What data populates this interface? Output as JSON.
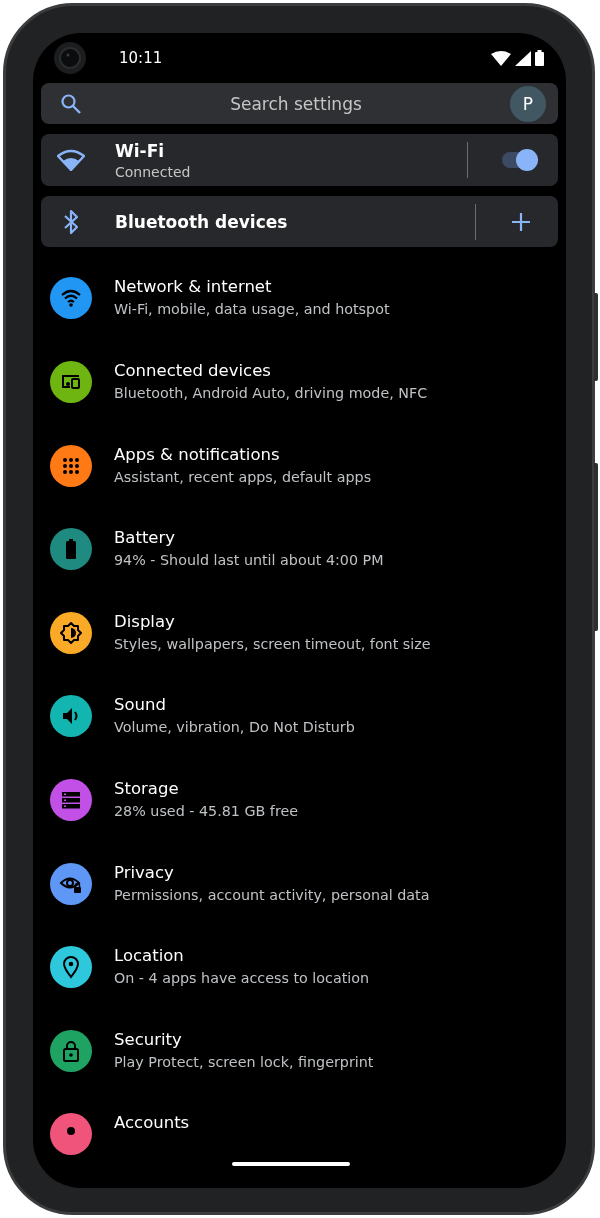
{
  "status_bar": {
    "time": "10:11"
  },
  "search": {
    "placeholder": "Search settings",
    "avatar": "P"
  },
  "quick_cards": [
    {
      "kind": "wifi",
      "title": "Wi-Fi",
      "subtitle": "Connected",
      "on": true
    },
    {
      "kind": "bluetooth",
      "title": "Bluetooth devices"
    }
  ],
  "items": [
    {
      "kind": "network",
      "title": "Network & internet",
      "subtitle": "Wi-Fi, mobile, data usage, and hotspot",
      "color": "#2196f3"
    },
    {
      "kind": "devices",
      "title": "Connected devices",
      "subtitle": "Bluetooth, Android Auto, driving mode, NFC",
      "color": "#6fb512"
    },
    {
      "kind": "apps",
      "title": "Apps & notifications",
      "subtitle": "Assistant, recent apps, default apps",
      "color": "#ff7a14"
    },
    {
      "kind": "battery",
      "title": "Battery",
      "subtitle": "94% - Should last until about 4:00 PM",
      "color": "#1f8a80"
    },
    {
      "kind": "display",
      "title": "Display",
      "subtitle": "Styles, wallpapers, screen timeout, font size",
      "color": "#fbaa27"
    },
    {
      "kind": "sound",
      "title": "Sound",
      "subtitle": "Volume, vibration, Do Not Disturb",
      "color": "#12b5b0"
    },
    {
      "kind": "storage",
      "title": "Storage",
      "subtitle": "28% used - 45.81 GB free",
      "color": "#c350e6"
    },
    {
      "kind": "privacy",
      "title": "Privacy",
      "subtitle": "Permissions, account activity, personal data",
      "color": "#5e97f6"
    },
    {
      "kind": "location",
      "title": "Location",
      "subtitle": "On - 4 apps have access to location",
      "color": "#2ec8dd"
    },
    {
      "kind": "security",
      "title": "Security",
      "subtitle": "Play Protect, screen lock, fingerprint",
      "color": "#1ea362"
    },
    {
      "kind": "accounts",
      "title": "Accounts",
      "color": "#f0547b"
    }
  ]
}
